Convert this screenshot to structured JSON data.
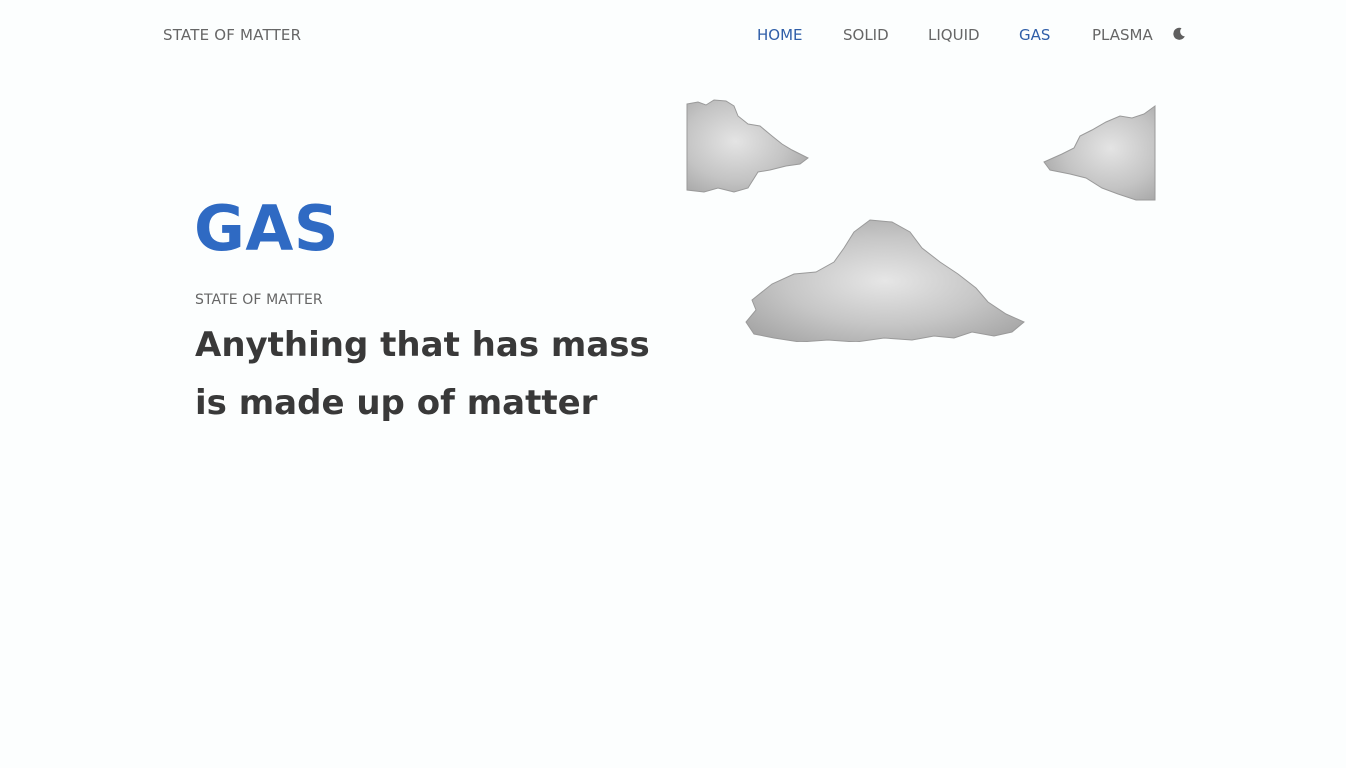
{
  "header": {
    "brand": "STATE OF MATTER",
    "nav": [
      {
        "label": "HOME"
      },
      {
        "label": "SOLID"
      },
      {
        "label": "LIQUID"
      },
      {
        "label": "GAS"
      },
      {
        "label": "PLASMA"
      }
    ],
    "theme_toggle_icon": "moon-icon"
  },
  "hero": {
    "title": "GAS",
    "subtitle": "STATE OF MATTER",
    "tagline": "Anything that has mass is made up of matter"
  },
  "images": {
    "clouds": [
      "cloud-image",
      "cloud-image",
      "cloud-image"
    ]
  },
  "colors": {
    "accent": "#2f6ac3",
    "nav_active": "#2f5ea8",
    "text": "#393939",
    "muted": "#666666",
    "background": "#fcfefe"
  }
}
